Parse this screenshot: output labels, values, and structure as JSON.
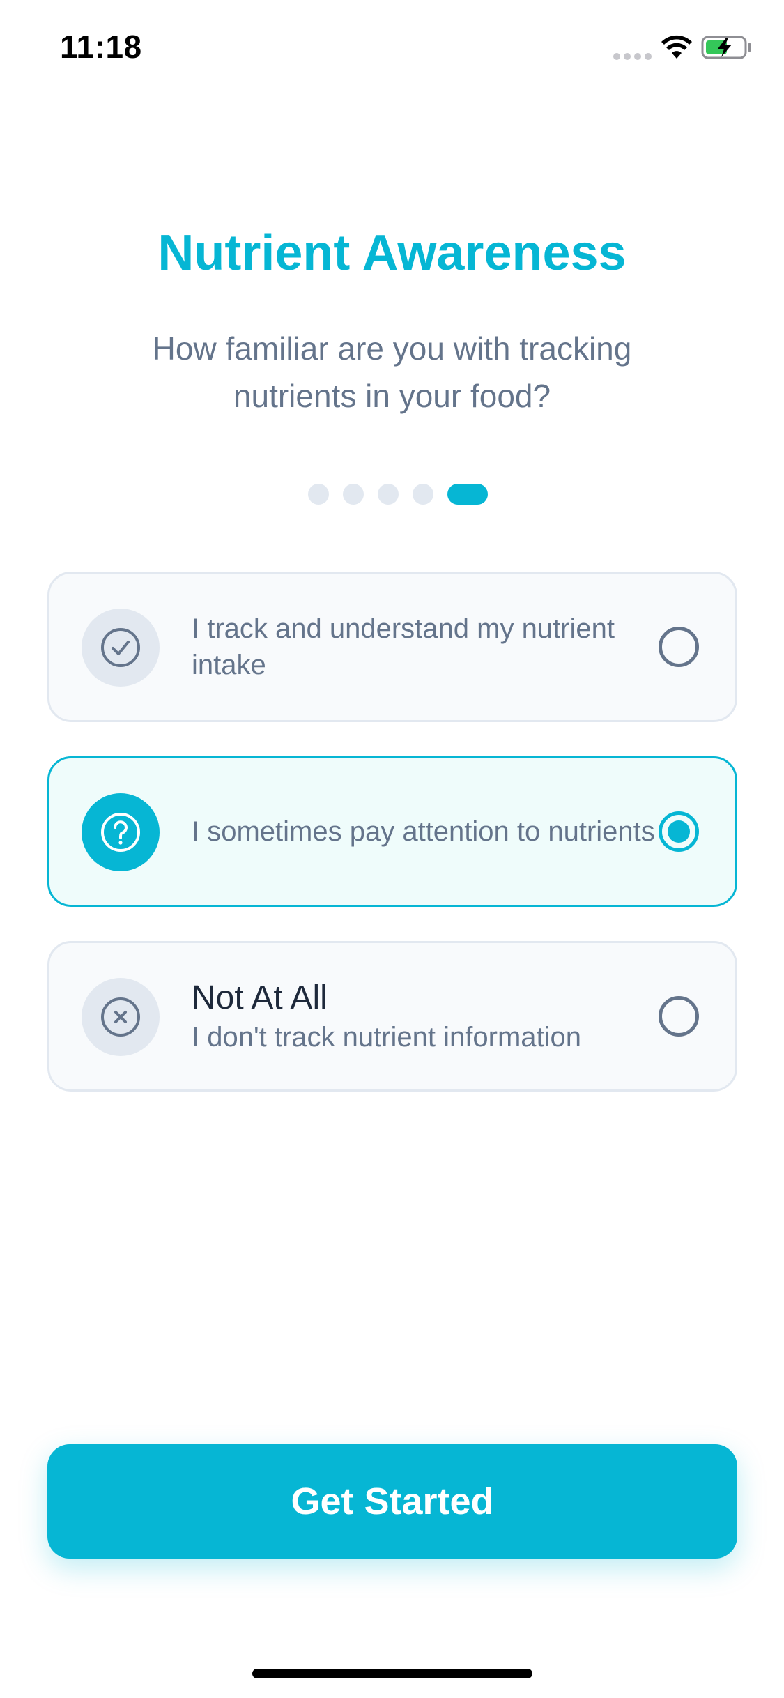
{
  "status_bar": {
    "time": "11:18",
    "icons": [
      "cellular-signal-icon",
      "wifi-icon",
      "battery-charging-icon"
    ]
  },
  "header": {
    "title": "Nutrient Awareness",
    "subtitle": "How familiar are you with tracking nutrients in your food?"
  },
  "pager": {
    "total_steps": 5,
    "current_step": 5
  },
  "options": [
    {
      "icon": "check-icon",
      "label": "I track and understand my nutrient intake",
      "selected": false
    },
    {
      "icon": "question-icon",
      "label": "I sometimes pay attention to nutrients",
      "selected": true
    },
    {
      "icon": "x-icon",
      "title": "Not At All",
      "subtitle": "I don't track nutrient information",
      "selected": false
    }
  ],
  "cta": {
    "label": "Get Started"
  },
  "colors": {
    "accent": "#06b6d4",
    "muted_text": "#64748b",
    "card_border": "#e2e8f0",
    "card_background": "#f8fafc",
    "selected_background": "#effcfb"
  }
}
